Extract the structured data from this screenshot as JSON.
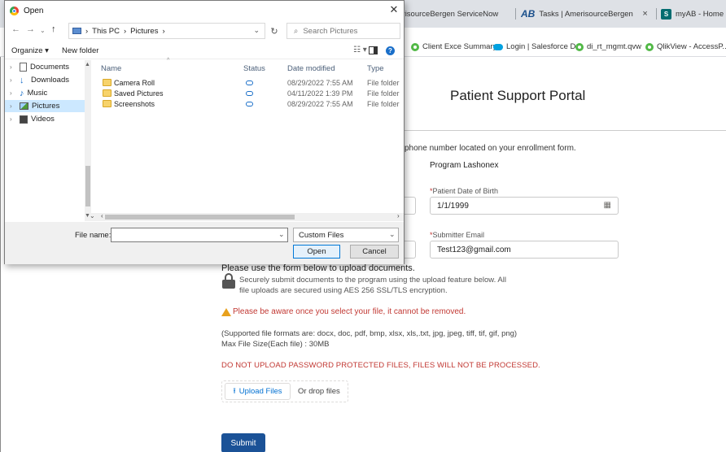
{
  "browser": {
    "tabs": [
      {
        "label": "AmerisourceBergen ServiceNow",
        "close": "×"
      },
      {
        "label": "Tasks | AmerisourceBergen Serv",
        "logo": "AB",
        "close": "×"
      },
      {
        "label": "myAB - Home",
        "logo": "S"
      }
    ],
    "bookmarks": [
      {
        "label": "Client Exce Summary",
        "icon": "qlik-icon"
      },
      {
        "label": "Login | Salesforce D...",
        "icon": "salesforce-icon"
      },
      {
        "label": "di_rt_mgmt.qvw",
        "icon": "qlik-icon"
      },
      {
        "label": "QlikView - AccessP...",
        "icon": "qlik-icon"
      }
    ]
  },
  "portal": {
    "title": "Patient Support Portal",
    "instruction_fragment": "phone number located on your enrollment form.",
    "program": "Program Lashonex",
    "dob": {
      "label": "Patient Date of Birth",
      "required_mark": "*",
      "value": "1/1/1999"
    },
    "email": {
      "label": "Submitter Email",
      "required_mark": "*",
      "value": "Test123@gmail.com"
    },
    "upload_title": "Please use the form below to upload documents.",
    "secure_line1": "Securely submit documents to the program using the upload feature below. All",
    "secure_line2": "file uploads are secured using AES 256 SSL/TLS encryption.",
    "warning": "Please be aware once you select your file, it cannot be removed.",
    "formats": "(Supported file formats are: docx, doc, pdf, bmp, xlsx, xls,.txt, jpg, jpeg, tiff, tif, gif, png)",
    "max_size": "Max File Size(Each file) : 30MB",
    "no_password": "DO NOT UPLOAD PASSWORD PROTECTED FILES, FILES WILL NOT BE PROCESSED.",
    "upload_button": "Upload Files",
    "drop_text": "Or drop files",
    "submit": "Submit"
  },
  "dialog": {
    "title": "Open",
    "breadcrumb": [
      "This PC",
      "Pictures"
    ],
    "search_placeholder": "Search Pictures",
    "organize": "Organize ▾",
    "new_folder": "New folder",
    "nav_items": [
      {
        "label": "Documents"
      },
      {
        "label": "Downloads"
      },
      {
        "label": "Music"
      },
      {
        "label": "Pictures",
        "selected": true
      },
      {
        "label": "Videos"
      }
    ],
    "columns": {
      "name": "Name",
      "status": "Status",
      "date": "Date modified",
      "type": "Type"
    },
    "files": [
      {
        "name": "Camera Roll",
        "date": "08/29/2022 7:55 AM",
        "type": "File folder"
      },
      {
        "name": "Saved Pictures",
        "date": "04/11/2022 1:39 PM",
        "type": "File folder"
      },
      {
        "name": "Screenshots",
        "date": "08/29/2022 7:55 AM",
        "type": "File folder"
      }
    ],
    "file_name_label": "File name:",
    "file_name_value": "",
    "file_type": "Custom Files",
    "open": "Open",
    "cancel": "Cancel"
  }
}
